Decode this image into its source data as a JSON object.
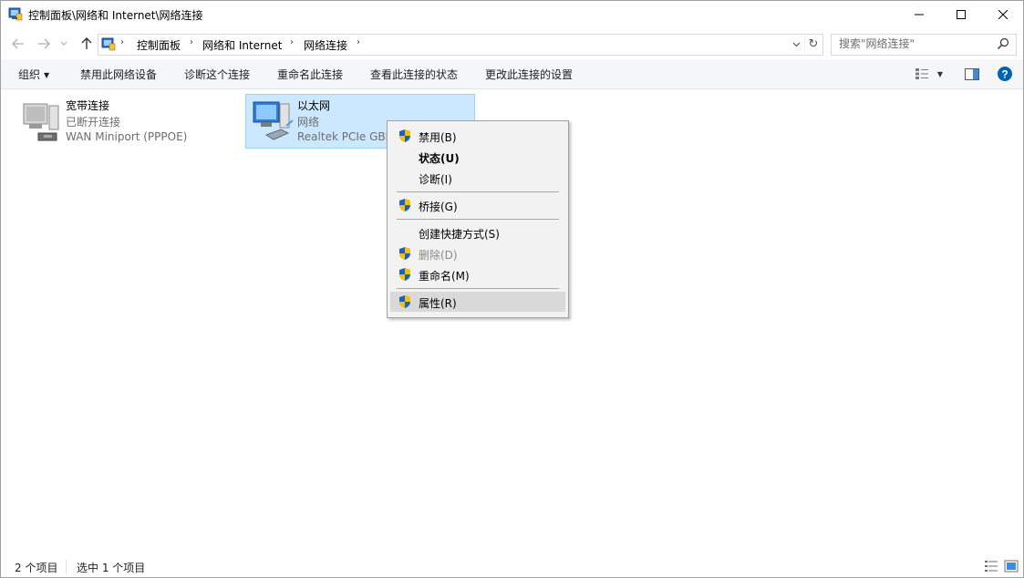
{
  "window": {
    "title": "控制面板\\网络和 Internet\\网络连接"
  },
  "address": {
    "crumbs": [
      "控制面板",
      "网络和 Internet",
      "网络连接"
    ]
  },
  "search": {
    "placeholder": "搜索\"网络连接\""
  },
  "toolbar": {
    "organize": "组织",
    "disable_device": "禁用此网络设备",
    "diagnose": "诊断这个连接",
    "rename": "重命名此连接",
    "view_status": "查看此连接的状态",
    "change_settings": "更改此连接的设置"
  },
  "connections": [
    {
      "name": "宽带连接",
      "status": "已断开连接",
      "device": "WAN Miniport (PPPOE)",
      "selected": false
    },
    {
      "name": "以太网",
      "status": "网络",
      "device": "Realtek PCIe GBE",
      "selected": true
    }
  ],
  "context_menu": {
    "disable": "禁用(B)",
    "status": "状态(U)",
    "diagnose": "诊断(I)",
    "bridge": "桥接(G)",
    "shortcut": "创建快捷方式(S)",
    "delete": "删除(D)",
    "rename": "重命名(M)",
    "properties": "属性(R)"
  },
  "statusbar": {
    "item_count": "2 个项目",
    "selected_count": "选中 1 个项目"
  },
  "colors": {
    "selection_bg": "#cce8ff",
    "selection_border": "#99d1ff",
    "help_blue": "#0063b1",
    "menu_bg": "#f2f2f2"
  }
}
